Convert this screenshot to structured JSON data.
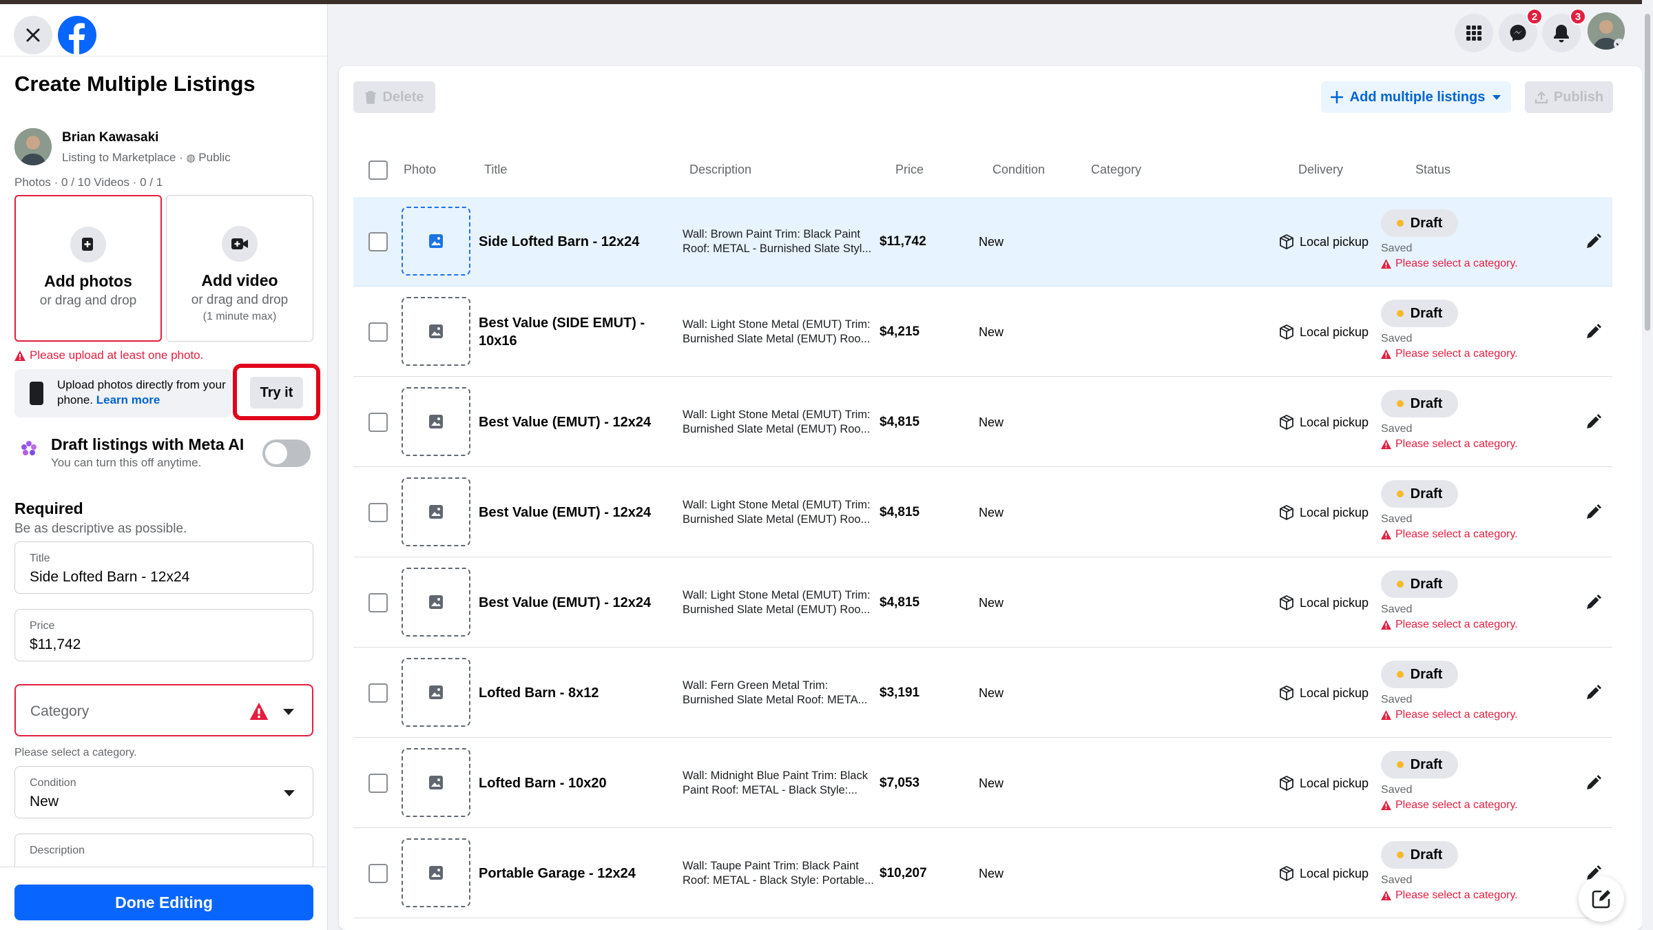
{
  "header": {
    "close_icon": "close-icon",
    "logo": "facebook-logo",
    "badges": {
      "messenger": "2",
      "notifications": "3"
    }
  },
  "sidebar": {
    "title": "Create Multiple Listings",
    "user_name": "Brian Kawasaki",
    "user_sub": "Listing to Marketplace · ",
    "visibility": "Public",
    "counts": "Photos · 0 / 10 Videos · 0 / 1",
    "add_photos": {
      "title": "Add photos",
      "sub": "or drag and drop"
    },
    "add_video": {
      "title": "Add video",
      "sub": "or drag and drop",
      "note": "(1 minute max)"
    },
    "photo_error": "Please upload at least one photo.",
    "upload_text": "Upload photos directly from your phone.",
    "learn_more": "Learn more",
    "try_it": "Try it",
    "ai_title": "Draft listings with Meta AI",
    "ai_sub": "You can turn this off anytime.",
    "required": "Required",
    "required_sub": "Be as descriptive as possible.",
    "title_field": {
      "label": "Title",
      "value": "Side Lofted Barn - 12x24"
    },
    "price_field": {
      "label": "Price",
      "value": "$11,742"
    },
    "category_field": {
      "placeholder": "Category",
      "help": "Please select a category."
    },
    "condition_field": {
      "label": "Condition",
      "value": "New"
    },
    "description_field": {
      "label": "Description"
    },
    "done_button": "Done Editing"
  },
  "toolbar": {
    "delete": "Delete",
    "add_multiple": "Add multiple listings",
    "publish": "Publish"
  },
  "table": {
    "columns": {
      "photo": "Photo",
      "title": "Title",
      "description": "Description",
      "price": "Price",
      "condition": "Condition",
      "category": "Category",
      "delivery": "Delivery",
      "status": "Status"
    },
    "rows": [
      {
        "title": "Side Lofted Barn - 12x24",
        "description": "Wall: Brown Paint Trim: Black Paint Roof: METAL - Burnished Slate Styl...",
        "price": "$11,742",
        "condition": "New",
        "delivery": "Local pickup",
        "status": "Draft",
        "saved": "Saved",
        "error": "Please select a category."
      },
      {
        "title": "Best Value (SIDE EMUT) - 10x16",
        "description": "Wall: Light Stone Metal (EMUT) Trim: Burnished Slate Metal (EMUT) Roo...",
        "price": "$4,215",
        "condition": "New",
        "delivery": "Local pickup",
        "status": "Draft",
        "saved": "Saved",
        "error": "Please select a category."
      },
      {
        "title": "Best Value (EMUT) - 12x24",
        "description": "Wall: Light Stone Metal (EMUT) Trim: Burnished Slate Metal (EMUT) Roo...",
        "price": "$4,815",
        "condition": "New",
        "delivery": "Local pickup",
        "status": "Draft",
        "saved": "Saved",
        "error": "Please select a category."
      },
      {
        "title": "Best Value (EMUT) - 12x24",
        "description": "Wall: Light Stone Metal (EMUT) Trim: Burnished Slate Metal (EMUT) Roo...",
        "price": "$4,815",
        "condition": "New",
        "delivery": "Local pickup",
        "status": "Draft",
        "saved": "Saved",
        "error": "Please select a category."
      },
      {
        "title": "Best Value (EMUT) - 12x24",
        "description": "Wall: Light Stone Metal (EMUT) Trim: Burnished Slate Metal (EMUT) Roo...",
        "price": "$4,815",
        "condition": "New",
        "delivery": "Local pickup",
        "status": "Draft",
        "saved": "Saved",
        "error": "Please select a category."
      },
      {
        "title": "Lofted Barn - 8x12",
        "description": "Wall: Fern Green Metal Trim: Burnished Slate Metal Roof: META...",
        "price": "$3,191",
        "condition": "New",
        "delivery": "Local pickup",
        "status": "Draft",
        "saved": "Saved",
        "error": "Please select a category."
      },
      {
        "title": "Lofted Barn - 10x20",
        "description": "Wall: Midnight Blue Paint Trim: Black Paint Roof: METAL - Black Style:...",
        "price": "$7,053",
        "condition": "New",
        "delivery": "Local pickup",
        "status": "Draft",
        "saved": "Saved",
        "error": "Please select a category."
      },
      {
        "title": "Portable Garage - 12x24",
        "description": "Wall: Taupe Paint Trim: Black Paint Roof: METAL - Black Style: Portable...",
        "price": "$10,207",
        "condition": "New",
        "delivery": "Local pickup",
        "status": "Draft",
        "saved": "Saved",
        "error": "Please select a category."
      }
    ]
  },
  "colors": {
    "accent": "#0866ff",
    "error": "#e41e3f",
    "highlight": "#e0021a",
    "selected_row": "#e7f3ff"
  }
}
